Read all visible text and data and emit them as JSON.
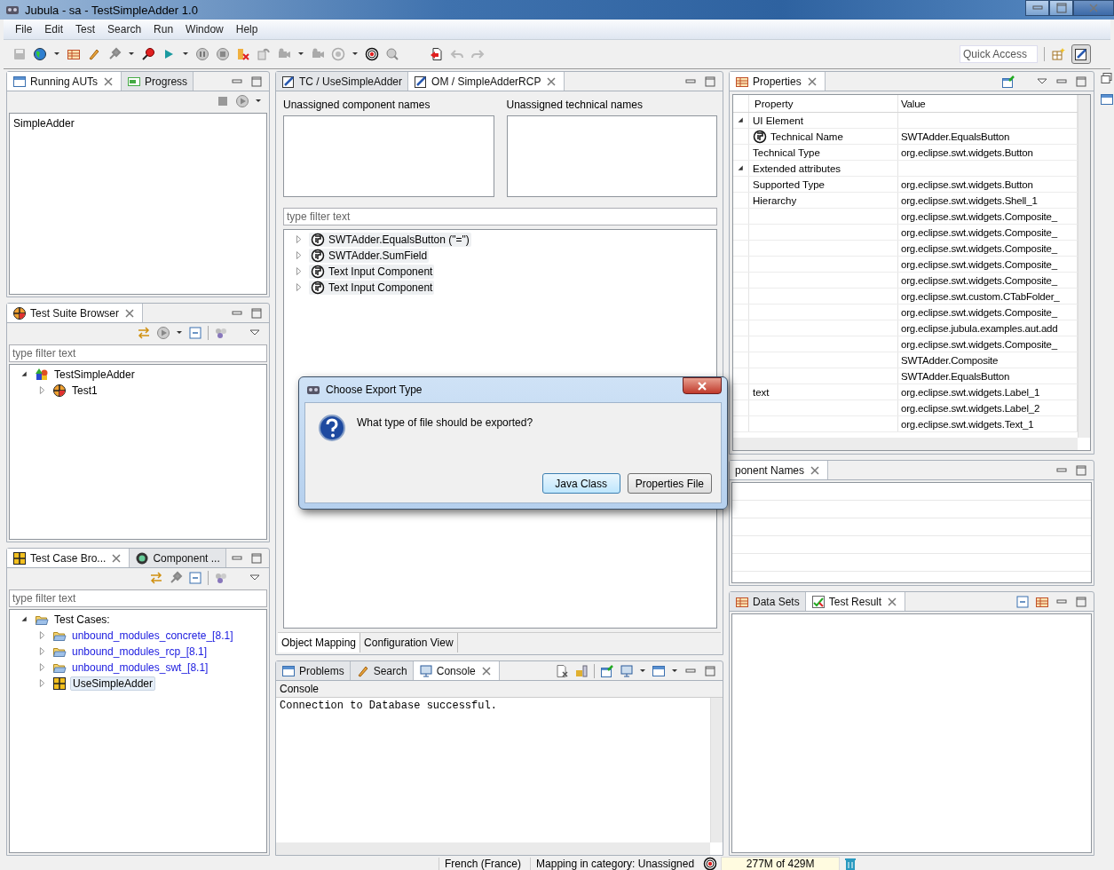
{
  "window": {
    "title": "Jubula - sa - TestSimpleAdder 1.0"
  },
  "menu": [
    "File",
    "Edit",
    "Test",
    "Search",
    "Run",
    "Window",
    "Help"
  ],
  "quick_access": {
    "placeholder": "Quick Access"
  },
  "running_auts": {
    "tabs": [
      {
        "label": "Running AUTs",
        "selected": true
      },
      {
        "label": "Progress",
        "selected": false
      }
    ],
    "items": [
      "SimpleAdder"
    ]
  },
  "test_suite_browser": {
    "tabs": [
      {
        "label": "Test Suite Browser",
        "selected": true
      }
    ],
    "filter": {
      "placeholder": "type filter text"
    },
    "tree": [
      {
        "label": "TestSimpleAdder",
        "kind": "suite",
        "expanded": true,
        "selected": false,
        "children": [
          {
            "label": "Test1",
            "kind": "test",
            "expanded": false,
            "selected": false
          }
        ]
      }
    ]
  },
  "test_case_browser": {
    "tabs": [
      {
        "label": "Test Case Bro...",
        "selected": true
      },
      {
        "label": "Component ...",
        "selected": false
      }
    ],
    "filter": {
      "placeholder": "type filter text"
    },
    "tree": [
      {
        "label": "Test Cases:",
        "kind": "folder",
        "expanded": true,
        "selected": false,
        "children": [
          {
            "label": "unbound_modules_concrete_[8.1]",
            "kind": "reused_folder",
            "expanded": false,
            "selected": false
          },
          {
            "label": "unbound_modules_rcp_[8.1]",
            "kind": "reused_folder",
            "expanded": false,
            "selected": false
          },
          {
            "label": "unbound_modules_swt_[8.1]",
            "kind": "reused_folder",
            "expanded": false,
            "selected": false
          },
          {
            "label": "UseSimpleAdder",
            "kind": "testcase",
            "expanded": false,
            "selected": true
          }
        ]
      }
    ]
  },
  "editor": {
    "tabs": [
      {
        "label": "TC / UseSimpleAdder",
        "selected": false
      },
      {
        "label": "OM / SimpleAdderRCP",
        "selected": true
      }
    ],
    "unassigned_component_names": {
      "label": "Unassigned component names"
    },
    "unassigned_technical_names": {
      "label": "Unassigned technical names"
    },
    "filter": {
      "placeholder": "type filter text"
    },
    "tree": [
      {
        "label": "SWTAdder.EqualsButton (\"=\")",
        "kind": "component",
        "expanded": false,
        "selected": false
      },
      {
        "label": "SWTAdder.SumField",
        "kind": "component",
        "expanded": false,
        "selected": false
      },
      {
        "label": "Text Input Component",
        "kind": "component",
        "expanded": false,
        "selected": false
      },
      {
        "label": "Text Input Component",
        "kind": "component",
        "expanded": false,
        "selected": false
      }
    ],
    "bottom_tabs": [
      {
        "label": "Object Mapping",
        "selected": true
      },
      {
        "label": "Configuration View",
        "selected": false
      }
    ]
  },
  "console": {
    "tabs": [
      {
        "label": "Problems",
        "selected": false
      },
      {
        "label": "Search",
        "selected": false
      },
      {
        "label": "Console",
        "selected": true
      }
    ],
    "title": "Console",
    "lines": [
      "Connection to Database successful."
    ]
  },
  "properties": {
    "tabs": [
      {
        "label": "Properties",
        "selected": true
      }
    ],
    "columns": [
      "Property",
      "Value"
    ],
    "rows": [
      {
        "kind": "group",
        "property": "UI Element",
        "expanded": true
      },
      {
        "kind": "component",
        "property": "Technical Name",
        "value": "SWTAdder.EqualsButton"
      },
      {
        "kind": "field",
        "property": "Technical Type",
        "value": "org.eclipse.swt.widgets.Button"
      },
      {
        "kind": "group",
        "property": "Extended attributes",
        "expanded": true
      },
      {
        "kind": "field",
        "property": "Supported Type",
        "value": "org.eclipse.swt.widgets.Button"
      },
      {
        "kind": "field",
        "property": "Hierarchy",
        "value": "org.eclipse.swt.widgets.Shell_1"
      },
      {
        "kind": "field",
        "value": "org.eclipse.swt.widgets.Composite_"
      },
      {
        "kind": "field",
        "value": "org.eclipse.swt.widgets.Composite_"
      },
      {
        "kind": "field",
        "value": "org.eclipse.swt.widgets.Composite_"
      },
      {
        "kind": "field",
        "value": "org.eclipse.swt.widgets.Composite_"
      },
      {
        "kind": "field",
        "value": "org.eclipse.swt.widgets.Composite_"
      },
      {
        "kind": "field",
        "value": "org.eclipse.swt.custom.CTabFolder_"
      },
      {
        "kind": "field",
        "value": "org.eclipse.swt.widgets.Composite_"
      },
      {
        "kind": "field",
        "value": "org.eclipse.jubula.examples.aut.add"
      },
      {
        "kind": "field",
        "value": "org.eclipse.swt.widgets.Composite_"
      },
      {
        "kind": "field",
        "value": "SWTAdder.Composite"
      },
      {
        "kind": "field",
        "value": "SWTAdder.EqualsButton"
      },
      {
        "kind": "field",
        "property": "text",
        "value": "org.eclipse.swt.widgets.Label_1"
      },
      {
        "kind": "field",
        "value": "org.eclipse.swt.widgets.Label_2"
      },
      {
        "kind": "field",
        "value": "org.eclipse.swt.widgets.Text_1"
      }
    ]
  },
  "component_names": {
    "tabs": [
      {
        "label": "ponent Names",
        "selected": true
      }
    ]
  },
  "data_panel": {
    "tabs": [
      {
        "label": "Data Sets",
        "selected": false
      },
      {
        "label": "Test Result",
        "selected": true
      }
    ]
  },
  "dialog": {
    "title": "Choose Export Type",
    "message": "What type of file should be exported?",
    "buttons": [
      {
        "label": "Java Class",
        "default": true
      },
      {
        "label": "Properties File",
        "default": false
      }
    ]
  },
  "status_bar": {
    "locale": "French (France)",
    "mapping": "Mapping in category: Unassigned",
    "memory": "277M of 429M"
  }
}
